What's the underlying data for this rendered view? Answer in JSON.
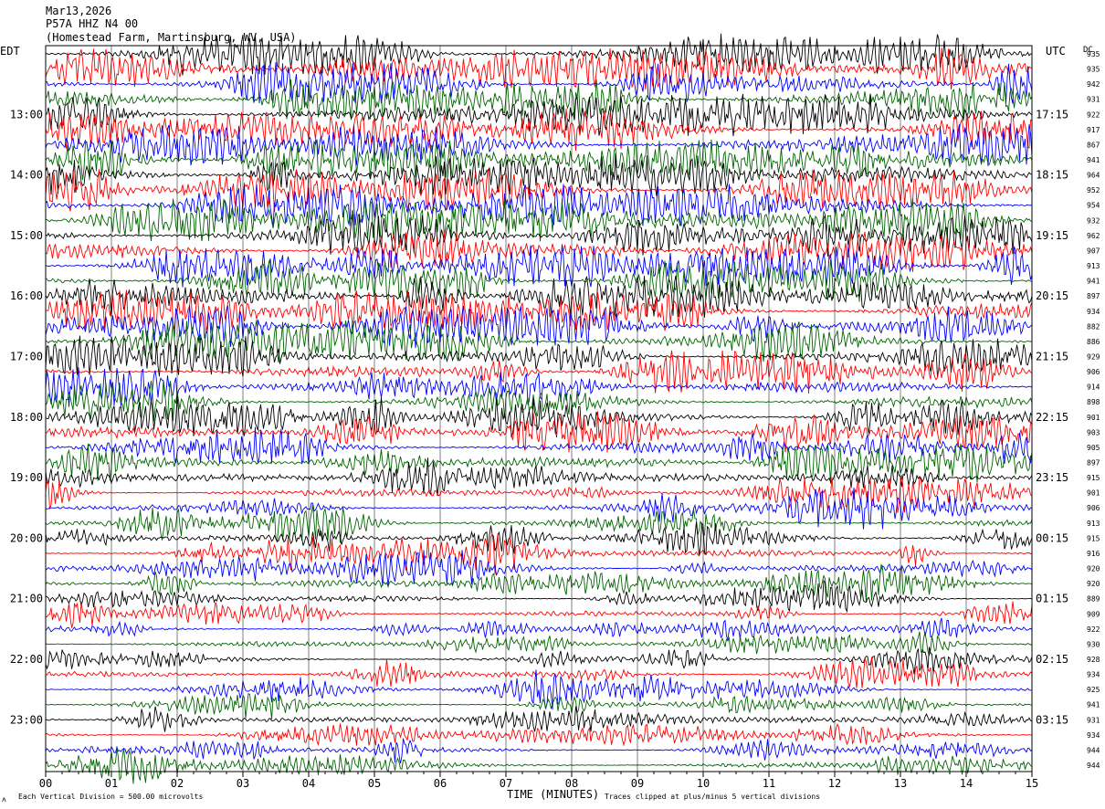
{
  "header": {
    "date": "Mar13,2026",
    "station": "P57A HHZ N4 00",
    "location": "(Homestead Farm, Martinsburg, WV, USA)"
  },
  "labels": {
    "left_tz": "EDT",
    "right_tz": "UTC",
    "dc_label": "DC",
    "bottom_left_mark": "ʌ",
    "bottom_left_note": "Each Vertical Division =  500.00 microvolts",
    "bottom_right_note": "Traces clipped at plus/minus 5 vertical divisions"
  },
  "chart_data": {
    "type": "line",
    "title": "",
    "xlabel": "TIME (MINUTES)",
    "ylabel": "",
    "x_ticks": [
      "00",
      "01",
      "02",
      "03",
      "04",
      "05",
      "06",
      "07",
      "08",
      "09",
      "10",
      "11",
      "12",
      "13",
      "14",
      "15"
    ],
    "xlim": [
      0,
      15
    ],
    "trace_count": 48,
    "trace_colors": [
      "#000000",
      "#ff0000",
      "#0000ff",
      "#006400"
    ],
    "left_time_labels": [
      "13:00",
      "14:00",
      "15:00",
      "16:00",
      "17:00",
      "18:00",
      "19:00",
      "20:00",
      "21:00",
      "22:00",
      "23:00"
    ],
    "right_time_labels": [
      "17:15",
      "18:15",
      "19:15",
      "20:15",
      "21:15",
      "22:15",
      "23:15",
      "00:15",
      "01:15",
      "02:15",
      "03:15"
    ],
    "dc_values": [
      "935",
      "935",
      "942",
      "931",
      "922",
      "917",
      "867",
      "941",
      "964",
      "952",
      "954",
      "932",
      "962",
      "907",
      "913",
      "941",
      "897",
      "934",
      "882",
      "886",
      "929",
      "906",
      "914",
      "898",
      "901",
      "903",
      "905",
      "897",
      "915",
      "901",
      "906",
      "913",
      "915",
      "916",
      "920",
      "920",
      "889",
      "909",
      "922",
      "930",
      "928",
      "934",
      "925",
      "941",
      "931",
      "934",
      "944",
      "944"
    ],
    "vertical_grid": true
  }
}
